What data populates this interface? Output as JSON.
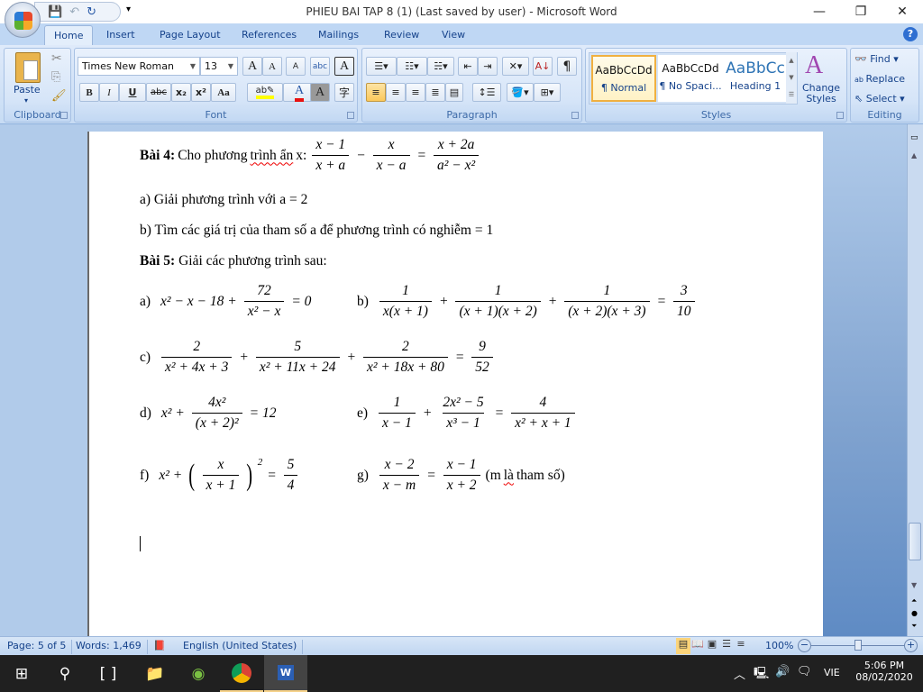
{
  "window": {
    "title": "PHIEU BAI TAP 8 (1) (Last saved by user) - Microsoft Word"
  },
  "tabs": [
    "Home",
    "Insert",
    "Page Layout",
    "References",
    "Mailings",
    "Review",
    "View"
  ],
  "clipboard": {
    "group": "Clipboard",
    "paste": "Paste"
  },
  "font": {
    "group": "Font",
    "name": "Times New Roman",
    "size": "13",
    "bold": "B",
    "italic": "I",
    "underline": "U",
    "strike": "abc",
    "subscript": "x₂",
    "superscript": "x²",
    "case": "Aa",
    "grow": "A",
    "shrink": "A",
    "clear": "A",
    "phonetic": "abc",
    "border": "A",
    "shade": "A",
    "enclose": "字",
    "highlight_color": "#ffff00",
    "font_color": "#e81010"
  },
  "paragraph": {
    "group": "Paragraph",
    "pilcrow": "¶"
  },
  "styles": {
    "group": "Styles",
    "items": [
      {
        "preview": "AaBbCcDd",
        "name": "¶ Normal"
      },
      {
        "preview": "AaBbCcDd",
        "name": "¶ No Spaci..."
      },
      {
        "preview": "AaBbCc",
        "name": "Heading 1"
      }
    ],
    "change": "Change Styles"
  },
  "editing": {
    "group": "Editing",
    "find": "Find",
    "replace": "Replace",
    "select": "Select"
  },
  "doc": {
    "bai4_label": "Bài 4:",
    "bai4_text": "Cho phương",
    "bai4_squig": "trình ẩn",
    "bai4_tail": "x:",
    "bai4_eq": [
      {
        "f": [
          "x − 1",
          "x + a"
        ]
      },
      {
        "t": "−"
      },
      {
        "f": [
          "x",
          "x − a"
        ]
      },
      {
        "t": "="
      },
      {
        "f": [
          "x + 2a",
          "a² − x²"
        ]
      }
    ],
    "line_a": "a) Giải phương trình với a = 2",
    "line_b": "b) Tìm các giá trị của tham số a để phương trình có nghiễm = 1",
    "bai5_label": "Bài 5:",
    "bai5_text": "Giải các phương trình sau:",
    "equations": [
      {
        "label": "a)",
        "parts": [
          {
            "t": "x² − x − 18 +"
          },
          {
            "f": [
              "72",
              "x² − x"
            ]
          },
          {
            "t": "= 0"
          }
        ]
      },
      {
        "label": "b)",
        "parts": [
          {
            "f": [
              "1",
              "x(x + 1)"
            ]
          },
          {
            "t": "+"
          },
          {
            "f": [
              "1",
              "(x + 1)(x + 2)"
            ]
          },
          {
            "t": "+"
          },
          {
            "f": [
              "1",
              "(x + 2)(x + 3)"
            ]
          },
          {
            "t": "="
          },
          {
            "f": [
              "3",
              "10"
            ]
          }
        ]
      },
      {
        "label": "c)",
        "parts": [
          {
            "f": [
              "2",
              "x² + 4x + 3"
            ]
          },
          {
            "t": "+"
          },
          {
            "f": [
              "5",
              "x² + 11x + 24"
            ]
          },
          {
            "t": "+"
          },
          {
            "f": [
              "2",
              "x² + 18x + 80"
            ]
          },
          {
            "t": "="
          },
          {
            "f": [
              "9",
              "52"
            ]
          }
        ]
      },
      {
        "label": "d)",
        "parts": [
          {
            "t": "x² +"
          },
          {
            "f": [
              "4x²",
              "(x + 2)²"
            ]
          },
          {
            "t": "= 12"
          }
        ]
      },
      {
        "label": "e)",
        "parts": [
          {
            "f": [
              "1",
              "x − 1"
            ]
          },
          {
            "t": "+"
          },
          {
            "f": [
              "2x² − 5",
              "x³ − 1"
            ]
          },
          {
            "t": "="
          },
          {
            "f": [
              "4",
              "x² + x + 1"
            ]
          }
        ]
      },
      {
        "label": "f)",
        "parts": [
          {
            "t": "x² +"
          },
          {
            "pf": [
              "x",
              "x + 1"
            ],
            "sup": "2"
          },
          {
            "t": "="
          },
          {
            "f": [
              "5",
              "4"
            ]
          }
        ]
      },
      {
        "label": "g)",
        "parts": [
          {
            "f": [
              "x − 2",
              "x − m"
            ]
          },
          {
            "t": "="
          },
          {
            "f": [
              "x − 1",
              "x + 2"
            ]
          }
        ],
        "note_pre": "(m",
        "note_squig": "là",
        "note_post": "tham số)"
      }
    ]
  },
  "status": {
    "page": "Page: 5 of 5",
    "words": "Words: 1,469",
    "language": "English (United States)",
    "zoom": "100%",
    "zoom_level_percent": 100
  },
  "taskbar": {
    "time": "5:06 PM",
    "date": "08/02/2020",
    "lang": "VIE"
  }
}
